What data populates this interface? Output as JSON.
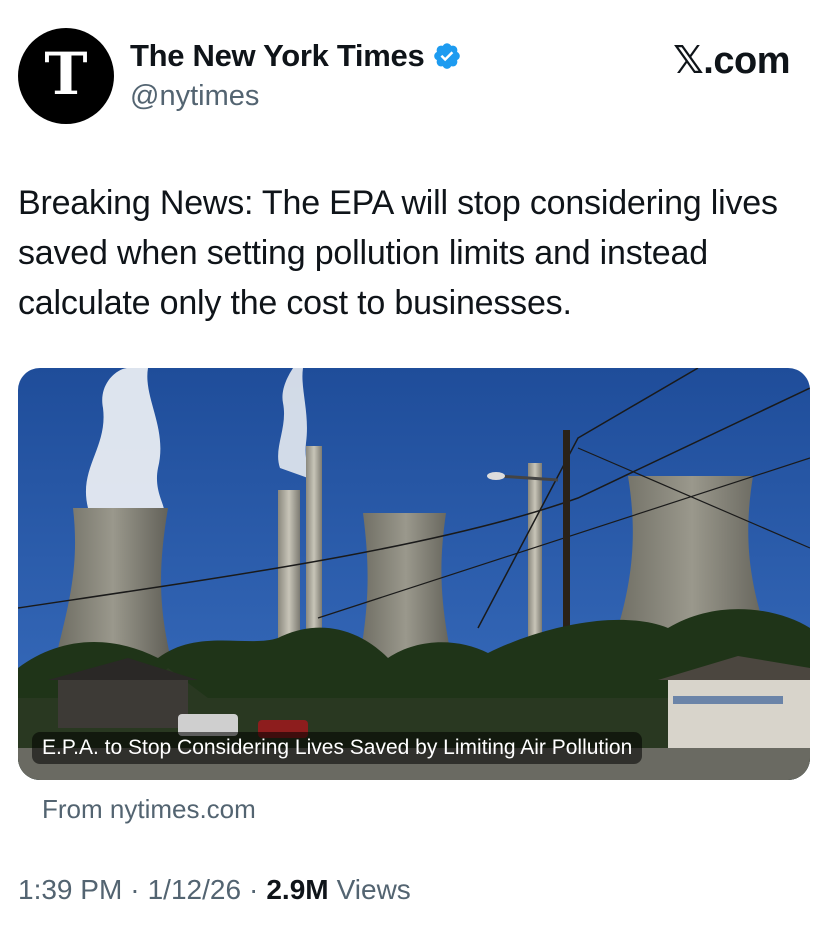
{
  "account": {
    "display_name": "The New York Times",
    "handle": "@nytimes",
    "avatar_glyph": "T",
    "verified": true,
    "verified_color": "#1d9bf0"
  },
  "site_logo": {
    "x_glyph": "𝕏",
    "suffix": ".com"
  },
  "tweet": {
    "text": "Breaking News: The EPA will stop considering lives saved when setting pollution limits and instead calculate only the cost to businesses."
  },
  "link_card": {
    "caption": "E.P.A. to Stop Considering Lives Saved by Limiting Air Pollution",
    "source": "From nytimes.com",
    "image_subject": "power plant cooling towers and smokestacks"
  },
  "meta": {
    "time": "1:39 PM",
    "date": "1/12/26",
    "views_count": "2.9M",
    "views_label": "Views",
    "separator": "·"
  },
  "colors": {
    "text_primary": "#0f1419",
    "text_secondary": "#536471",
    "sky": "#2a5aa8"
  }
}
